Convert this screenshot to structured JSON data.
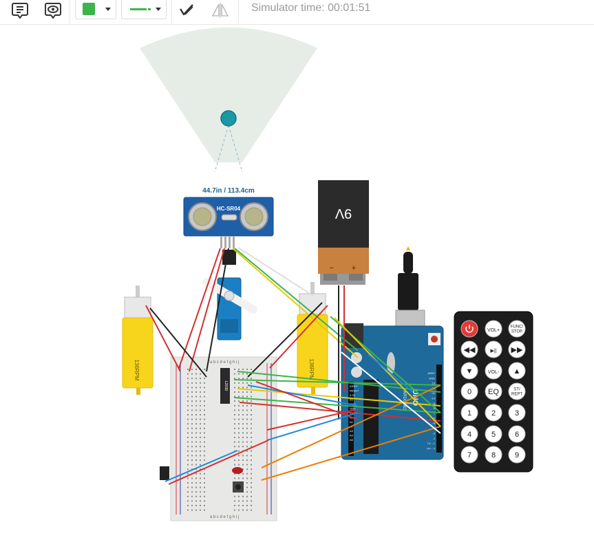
{
  "toolbar": {
    "notes_icon": "notes-icon",
    "view_icon": "eye-icon",
    "color_swatch": "#3cb44b",
    "line_style_color": "#3cb44b",
    "annotate_icon": "pen-check-icon",
    "mirror_icon": "flip-icon",
    "sim_time_label": "Simulator time: 00:01:51"
  },
  "circuit": {
    "distance_readout": "44.7in / 113.4cm",
    "sensor_label": "HC-SR04",
    "battery_label": "9V",
    "battery_minus": "−",
    "battery_plus": "+",
    "motor_left_label": "136RPM",
    "motor_right_label": "136RPM",
    "driver_chip_label": "L293D",
    "arduino_label": "UNO",
    "arduino_brand": "ARDUINO",
    "breadboard_top_letters": "a b c d e   f g h i j",
    "breadboard_bottom_letters": "a b c d e   f g h i j",
    "arduino_pins_left": [
      "IOREF",
      "RESET",
      "3.3V",
      "5V",
      "GND",
      "GND",
      "VIN",
      "A0",
      "A1",
      "A2",
      "A3",
      "A4",
      "A5"
    ],
    "arduino_pins_right": [
      "AREF",
      "GND",
      "13",
      "12",
      "~11",
      "~10",
      "~9",
      "8",
      "7",
      "~6",
      "~5",
      "4",
      "~3",
      "2",
      "TX→1",
      "RX←0"
    ]
  },
  "remote": {
    "rows": [
      [
        "power",
        "VOL+",
        "FUNC/\nSTOP"
      ],
      [
        "◀◀",
        "▶||",
        "▶▶"
      ],
      [
        "▼",
        "VOL-",
        "▲"
      ],
      [
        "0",
        "EQ",
        "ST/\nREPT"
      ],
      [
        "1",
        "2",
        "3"
      ],
      [
        "4",
        "5",
        "6"
      ],
      [
        "7",
        "8",
        "9"
      ]
    ],
    "power_color": "#e53935"
  }
}
